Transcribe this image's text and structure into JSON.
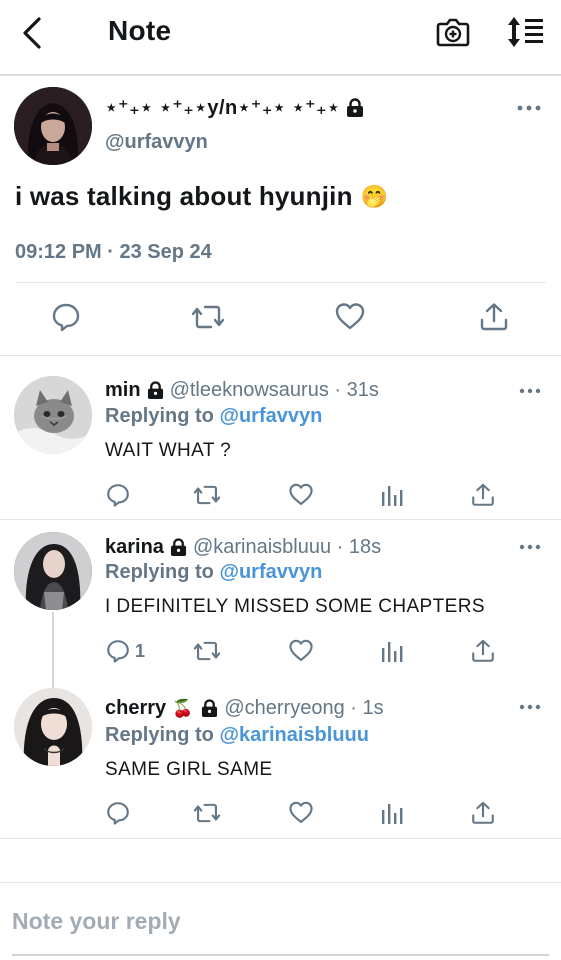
{
  "header": {
    "title": "Note"
  },
  "main_note": {
    "display_name": "⋆⁺₊⋆ ⋆⁺₊⋆y/n⋆⁺₊⋆ ⋆⁺₊⋆",
    "handle": "@urfavvyn",
    "text": "i was talking about hyunjin",
    "emoji": "🤭",
    "timestamp": "09:12 PM · 23 Sep 24"
  },
  "replies": [
    {
      "name": "min",
      "handle": "@tleeknowsaurus · 31s",
      "replying_prefix": "Replying to",
      "replying_to": "@urfavvyn",
      "text": "WAIT WHAT ?"
    },
    {
      "name": "karina",
      "handle": "@karinaisbluuu · 18s",
      "replying_prefix": "Replying to",
      "replying_to": "@urfavvyn",
      "text": "I DEFINITELY MISSED SOME CHAPTERS",
      "reply_count": "1"
    },
    {
      "name": "cherry",
      "name_emoji": "🍒",
      "handle": "@cherryeong · 1s",
      "replying_prefix": "Replying to",
      "replying_to": "@karinaisbluuu",
      "text": "SAME GIRL SAME"
    }
  ],
  "compose": {
    "placeholder": "Note your reply"
  },
  "colors": {
    "accent": "#4a95d8",
    "secondary_text": "#657786",
    "divider": "#e3e6e8"
  },
  "icons": [
    "back-chevron-icon",
    "camera-icon",
    "sort-icon",
    "lock-icon",
    "more-icon",
    "reply-icon",
    "renote-icon",
    "like-icon",
    "stats-icon",
    "share-icon"
  ]
}
